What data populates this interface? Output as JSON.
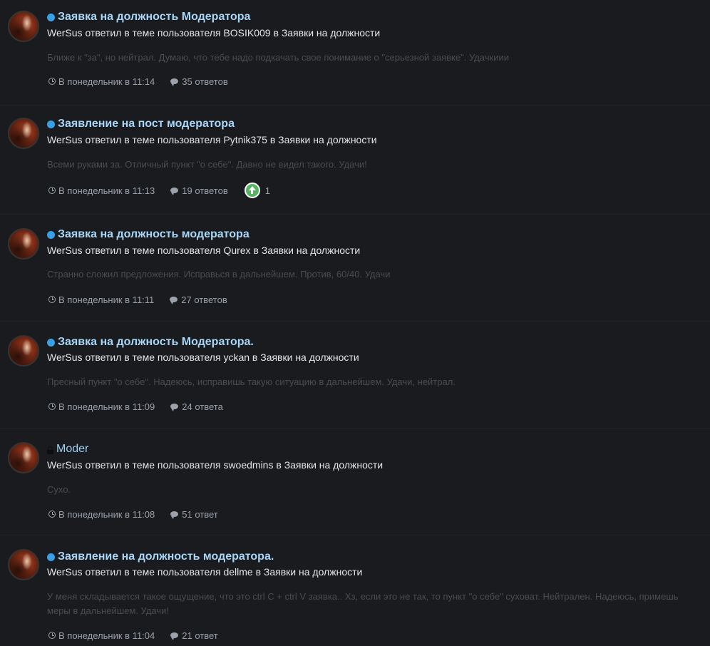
{
  "activity": [
    {
      "title": "Заявка на должность Модератора",
      "unread": true,
      "locked": false,
      "author": "WerSus",
      "action": "ответил в теме пользователя",
      "topic_owner": "BOSIK009",
      "forum_prefix": "в",
      "forum": "Заявки на должности",
      "excerpt": "Ближе к \"за\", но нейтрал. Думаю, что тебе надо подкачать свое понимание о \"серьезной заявке\". Удачкиии",
      "time": "В понедельник в 11:14",
      "replies": "35 ответов",
      "reaction_count": ""
    },
    {
      "title": "Заявление на пост модератора",
      "unread": true,
      "locked": false,
      "author": "WerSus",
      "action": "ответил в теме пользователя",
      "topic_owner": "Pytnik375",
      "forum_prefix": "в",
      "forum": "Заявки на должности",
      "excerpt": "Всеми руками за. Отличный пункт \"о себе\". Давно не видел такого. Удачи!",
      "time": "В понедельник в 11:13",
      "replies": "19 ответов",
      "reaction_count": "1"
    },
    {
      "title": "Заявка на должность модератора",
      "unread": true,
      "locked": false,
      "author": "WerSus",
      "action": "ответил в теме пользователя",
      "topic_owner": "Qurex",
      "forum_prefix": "в",
      "forum": "Заявки на должности",
      "excerpt": "Странно сложил предложения. Исправься в дальнейшем. Против, 60/40. Удачи",
      "time": "В понедельник в 11:11",
      "replies": "27 ответов",
      "reaction_count": ""
    },
    {
      "title": "Заявка на должность Модератора.",
      "unread": true,
      "locked": false,
      "author": "WerSus",
      "action": "ответил в теме пользователя",
      "topic_owner": "yckan",
      "forum_prefix": "в",
      "forum": "Заявки на должности",
      "excerpt": "Пресный пункт \"о себе\". Надеюсь, исправишь такую ситуацию в дальнейшем. Удачи, нейтрал.",
      "time": "В понедельник в 11:09",
      "replies": "24 ответа",
      "reaction_count": ""
    },
    {
      "title": "Moder",
      "unread": false,
      "locked": true,
      "author": "WerSus",
      "action": "ответил в теме пользователя",
      "topic_owner": "swoedmins",
      "forum_prefix": "в",
      "forum": "Заявки на должности",
      "excerpt": "Сухо.",
      "time": "В понедельник в 11:08",
      "replies": "51 ответ",
      "reaction_count": ""
    },
    {
      "title": "Заявление на должность модератора.",
      "unread": true,
      "locked": false,
      "author": "WerSus",
      "action": "ответил в теме пользователя",
      "topic_owner": "dellme",
      "forum_prefix": "в",
      "forum": "Заявки на должности",
      "excerpt": "У меня складывается такое ощущение, что это ctrl C + ctrl V заявка.. Хз, если это не так, то пункт \"о себе\" суховат. Нейтрален. Надеюсь, примешь меры в дальнейшем. Удачи!",
      "time": "В понедельник в 11:04",
      "replies": "21 ответ",
      "reaction_count": ""
    }
  ],
  "colors": {
    "page_background": "#17191d",
    "row_background": "#191b1f",
    "title": "#a8d6f7",
    "unread_dot": "#3aa0e6",
    "meta_text": "#e6e6e6",
    "excerpt_text": "#494c52",
    "footer_text": "#9ba2ab",
    "upvote_badge": "#55b45f"
  },
  "icons": {
    "unread": "unread-dot",
    "locked": "lock-icon",
    "time": "clock-icon",
    "replies": "comment-icon",
    "reaction": "upvote-arrow-icon"
  }
}
